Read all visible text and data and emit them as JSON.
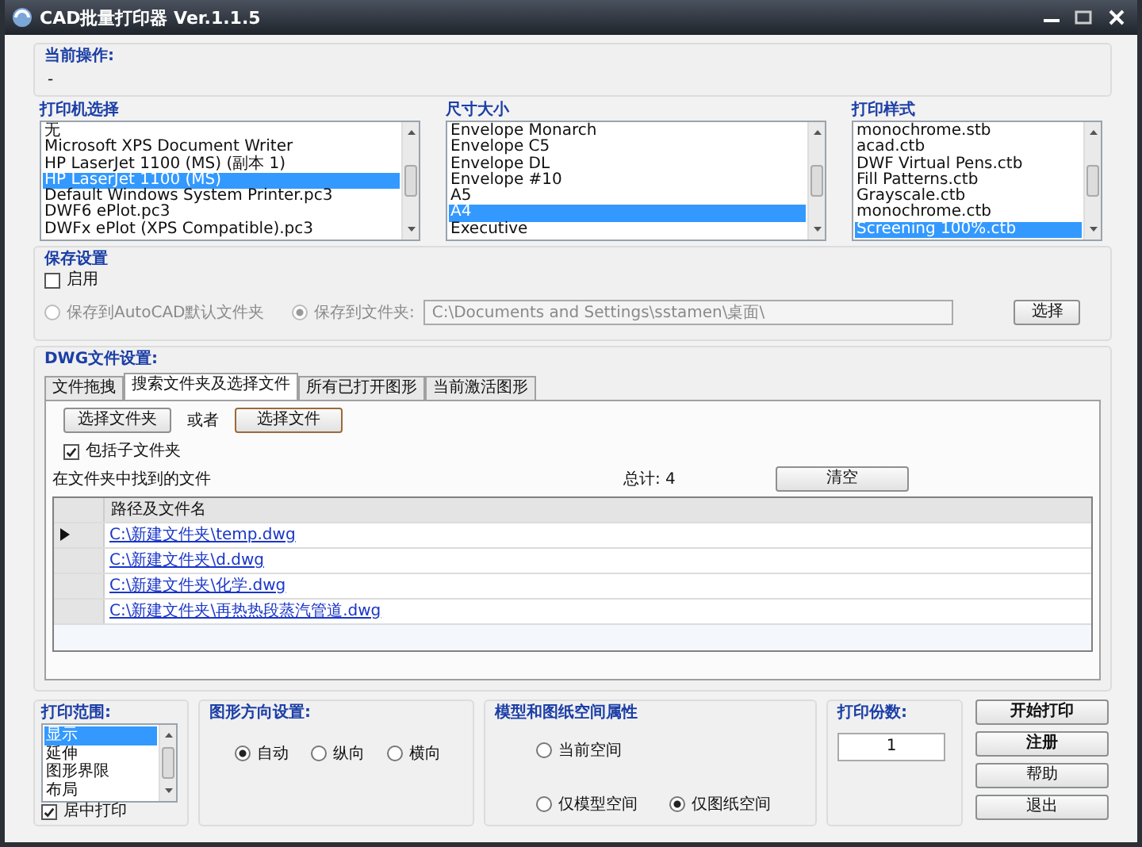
{
  "window": {
    "title": "CAD批量打印器 Ver.1.1.5"
  },
  "current_operation": {
    "label": "当前操作:",
    "value": "-"
  },
  "printer": {
    "label": "打印机选择",
    "items": [
      {
        "text": "无",
        "selected": false
      },
      {
        "text": "Microsoft XPS Document Writer",
        "selected": false
      },
      {
        "text": "HP LaserJet 1100 (MS) (副本 1)",
        "selected": false
      },
      {
        "text": "HP LaserJet 1100 (MS)",
        "selected": true
      },
      {
        "text": "Default Windows System Printer.pc3",
        "selected": false
      },
      {
        "text": "DWF6 ePlot.pc3",
        "selected": false
      },
      {
        "text": "DWFx ePlot (XPS Compatible).pc3",
        "selected": false
      }
    ]
  },
  "paper_size": {
    "label": "尺寸大小",
    "items": [
      {
        "text": "Envelope Monarch",
        "selected": false
      },
      {
        "text": "Envelope C5",
        "selected": false
      },
      {
        "text": "Envelope DL",
        "selected": false
      },
      {
        "text": "Envelope #10",
        "selected": false
      },
      {
        "text": "A5",
        "selected": false
      },
      {
        "text": "A4",
        "selected": true
      },
      {
        "text": "Executive",
        "selected": false
      }
    ]
  },
  "plot_style": {
    "label": "打印样式",
    "items": [
      {
        "text": "monochrome.stb",
        "selected": false
      },
      {
        "text": "acad.ctb",
        "selected": false
      },
      {
        "text": "DWF Virtual Pens.ctb",
        "selected": false
      },
      {
        "text": "Fill Patterns.ctb",
        "selected": false
      },
      {
        "text": "Grayscale.ctb",
        "selected": false
      },
      {
        "text": "monochrome.ctb",
        "selected": false
      },
      {
        "text": "Screening 100%.ctb",
        "selected": true
      }
    ]
  },
  "save_settings": {
    "label": "保存设置",
    "enable": {
      "label": "启用",
      "checked": false
    },
    "options": [
      {
        "label": "保存到AutoCAD默认文件夹",
        "selected": false,
        "disabled": true
      },
      {
        "label": "保存到文件夹:",
        "selected": true,
        "disabled": true
      }
    ],
    "path": "C:\\Documents and Settings\\sstamen\\桌面\\",
    "browse_button": "选择"
  },
  "dwg_settings": {
    "label": "DWG文件设置:",
    "tabs": [
      {
        "label": "文件拖拽",
        "selected": false
      },
      {
        "label": "搜索文件夹及选择文件",
        "selected": true
      },
      {
        "label": "所有已打开图形",
        "selected": false
      },
      {
        "label": "当前激活图形",
        "selected": false
      }
    ],
    "folder_button": "选择文件夹",
    "or_text": "或者",
    "file_button": "选择文件",
    "include_subfolders": {
      "label": "包括子文件夹",
      "checked": true
    },
    "found_label": "在文件夹中找到的文件",
    "total": "总计: 4",
    "clear_button": "清空",
    "table": {
      "columns": [
        "路径及文件名"
      ],
      "rows": [
        {
          "path": "C:\\新建文件夹\\temp.dwg",
          "current": true
        },
        {
          "path": "C:\\新建文件夹\\d.dwg",
          "current": false
        },
        {
          "path": "C:\\新建文件夹\\化学.dwg",
          "current": false
        },
        {
          "path": "C:\\新建文件夹\\再热热段蒸汽管道.dwg",
          "current": false
        }
      ]
    }
  },
  "print_range": {
    "label": "打印范围:",
    "items": [
      {
        "text": "显示",
        "selected": true
      },
      {
        "text": "延伸",
        "selected": false
      },
      {
        "text": "图形界限",
        "selected": false
      },
      {
        "text": "布局",
        "selected": false
      }
    ],
    "center": {
      "label": "居中打印",
      "checked": true
    }
  },
  "orientation": {
    "label": "图形方向设置:",
    "options": [
      {
        "label": "自动",
        "selected": true
      },
      {
        "label": "纵向",
        "selected": false
      },
      {
        "label": "横向",
        "selected": false
      }
    ]
  },
  "space": {
    "label": "模型和图纸空间属性",
    "options": [
      {
        "label": "当前空间",
        "selected": false
      },
      {
        "label": "仅模型空间",
        "selected": false
      },
      {
        "label": "仅图纸空间",
        "selected": true
      }
    ]
  },
  "copies": {
    "label": "打印份数:",
    "value": "1"
  },
  "actions": [
    {
      "label": "开始打印",
      "bold": true
    },
    {
      "label": "注册",
      "bold": true
    },
    {
      "label": "帮助",
      "bold": false
    },
    {
      "label": "退出",
      "bold": false
    }
  ]
}
